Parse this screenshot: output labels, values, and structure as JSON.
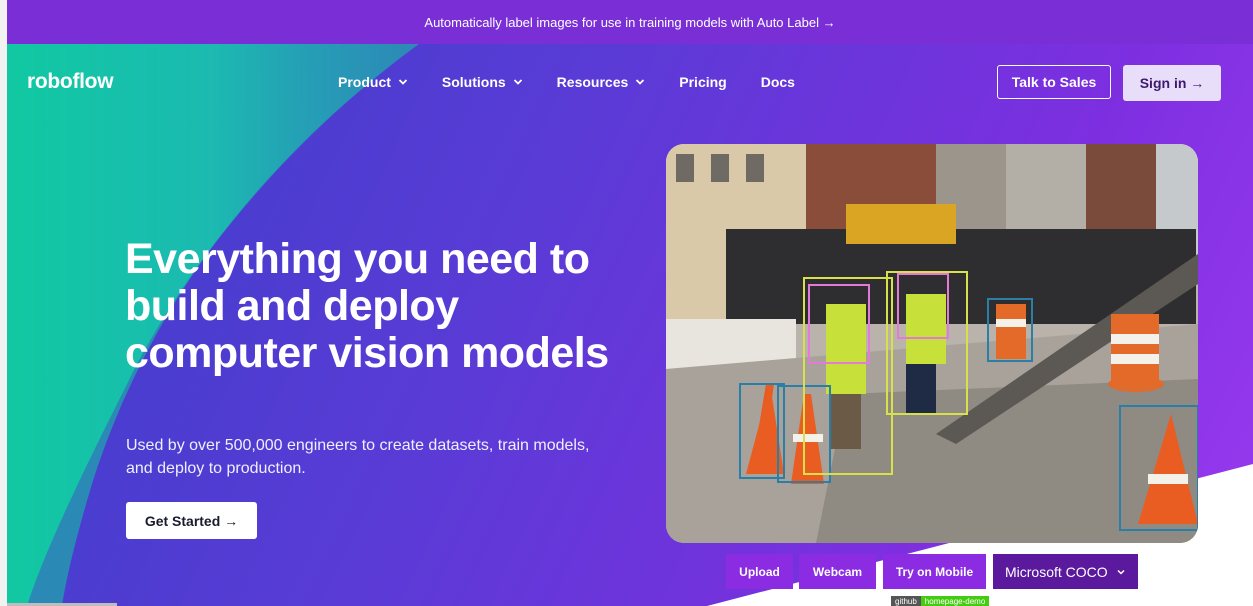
{
  "banner": {
    "text": "Automatically label images for use in training models with Auto Label →"
  },
  "header": {
    "logo": "roboflow",
    "nav": [
      {
        "label": "Product",
        "dropdown": true
      },
      {
        "label": "Solutions",
        "dropdown": true
      },
      {
        "label": "Resources",
        "dropdown": true
      },
      {
        "label": "Pricing",
        "dropdown": false
      },
      {
        "label": "Docs",
        "dropdown": false
      }
    ],
    "talk_to_sales": "Talk to Sales",
    "sign_in": "Sign in →"
  },
  "hero": {
    "headline": "Everything you need to build and deploy computer vision models",
    "subtext": "Used by over 500,000 engineers to create datasets, train models, and deploy to production.",
    "cta": "Get Started →"
  },
  "demo": {
    "buttons": [
      "Upload",
      "Webcam",
      "Try on Mobile"
    ],
    "model_select": "Microsoft COCO",
    "badge_left": "github",
    "badge_right": "homepage-demo"
  },
  "colors": {
    "banner": "#7a2fd6",
    "accent_teal": "#19c4a6",
    "demo_button": "#8b2be2",
    "select_bg": "#5b1a9e",
    "signin_bg": "#e9defa"
  }
}
